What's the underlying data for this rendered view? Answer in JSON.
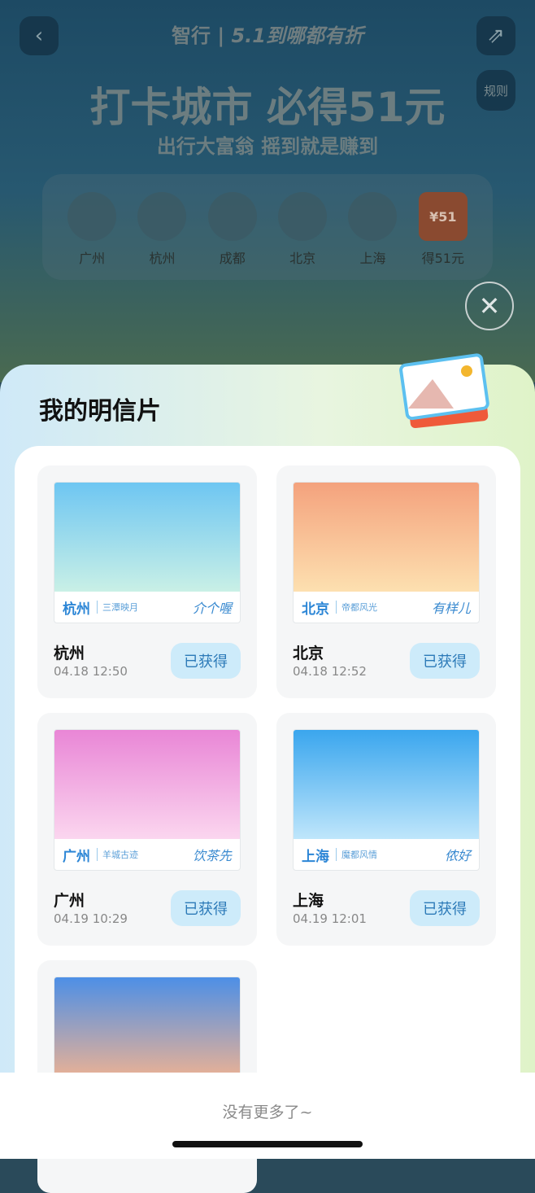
{
  "header": {
    "brand": "智行",
    "campaign": "5.1到哪都有折",
    "headline": "打卡城市 必得51元",
    "subtitle": "出行大富翁 摇到就是赚到",
    "rules": "规则"
  },
  "cities": [
    {
      "label": "广州"
    },
    {
      "label": "杭州"
    },
    {
      "label": "成都"
    },
    {
      "label": "北京"
    },
    {
      "label": "上海"
    },
    {
      "label": "得51元",
      "badge": "¥51"
    }
  ],
  "sheet": {
    "title": "我的明信片",
    "footer": "没有更多了~"
  },
  "postcards": [
    {
      "city": "杭州",
      "motto": "三潭映月",
      "sign": "介个喔",
      "name": "杭州",
      "time": "04.18 12:50",
      "status": "已获得",
      "colors": [
        "#6ec6f2",
        "#c9f0e6"
      ]
    },
    {
      "city": "北京",
      "motto": "帝都风光",
      "sign": "有样儿",
      "name": "北京",
      "time": "04.18 12:52",
      "status": "已获得",
      "colors": [
        "#f4a27d",
        "#fde0b0"
      ]
    },
    {
      "city": "广州",
      "motto": "羊城古迹",
      "sign": "饮茶先",
      "name": "广州",
      "time": "04.19 10:29",
      "status": "已获得",
      "colors": [
        "#e986d6",
        "#fbd6ef"
      ]
    },
    {
      "city": "上海",
      "motto": "魔都风情",
      "sign": "侬好",
      "name": "上海",
      "time": "04.19 12:01",
      "status": "已获得",
      "colors": [
        "#3aa6ee",
        "#bfe6fb"
      ]
    },
    {
      "colors": [
        "#4d8fe6",
        "#f7b48e"
      ]
    }
  ]
}
